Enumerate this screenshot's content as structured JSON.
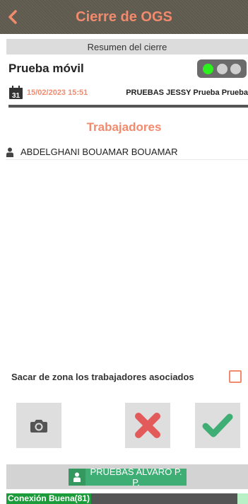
{
  "header": {
    "title": "Cierre de OGS",
    "back_icon": "chevron-left-icon"
  },
  "subheader": {
    "label": "Resumen del cierre"
  },
  "ogs": {
    "name": "Prueba móvil",
    "status_dots": [
      "on",
      "off",
      "off"
    ],
    "date": "15/02/2023 15:51",
    "user": "PRUEBAS JESSY Prueba Prueba",
    "calendar_icon": "calendar-icon",
    "calendar_day": "31"
  },
  "workers": {
    "title": "Trabajadores",
    "items": [
      {
        "name": "ABDELGHANI BOUAMAR BOUAMAR"
      }
    ]
  },
  "options": {
    "remove_workers_label": "Sacar de zona los trabajadores asociados",
    "remove_workers_checked": false
  },
  "actions": {
    "camera_icon": "camera-icon",
    "cancel_icon": "close-icon",
    "confirm_icon": "check-icon"
  },
  "footer": {
    "user_name": "PRUEBAS ALVARO P. P.",
    "connection": "Conexión Buena(81)"
  },
  "colors": {
    "accent": "#f28a6e",
    "header_bg": "#5f5a4e",
    "status_on": "#2cf11e",
    "success": "#3fae74",
    "cancel": "#e35a5a"
  }
}
